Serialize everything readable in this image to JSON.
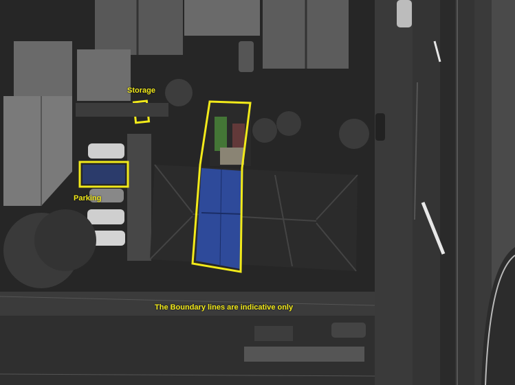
{
  "labels": {
    "storage": "Storage",
    "parking": "Parking",
    "disclaimer": "The Boundary lines are indicative only"
  },
  "colors": {
    "highlight": "#f2ea1a",
    "roof_highlight": "#2e4a9a",
    "road": "#303030",
    "lane_marking": "#e8e8e8",
    "roof_dark": "#2b2b2b",
    "greenery": "#4b8a3a"
  }
}
